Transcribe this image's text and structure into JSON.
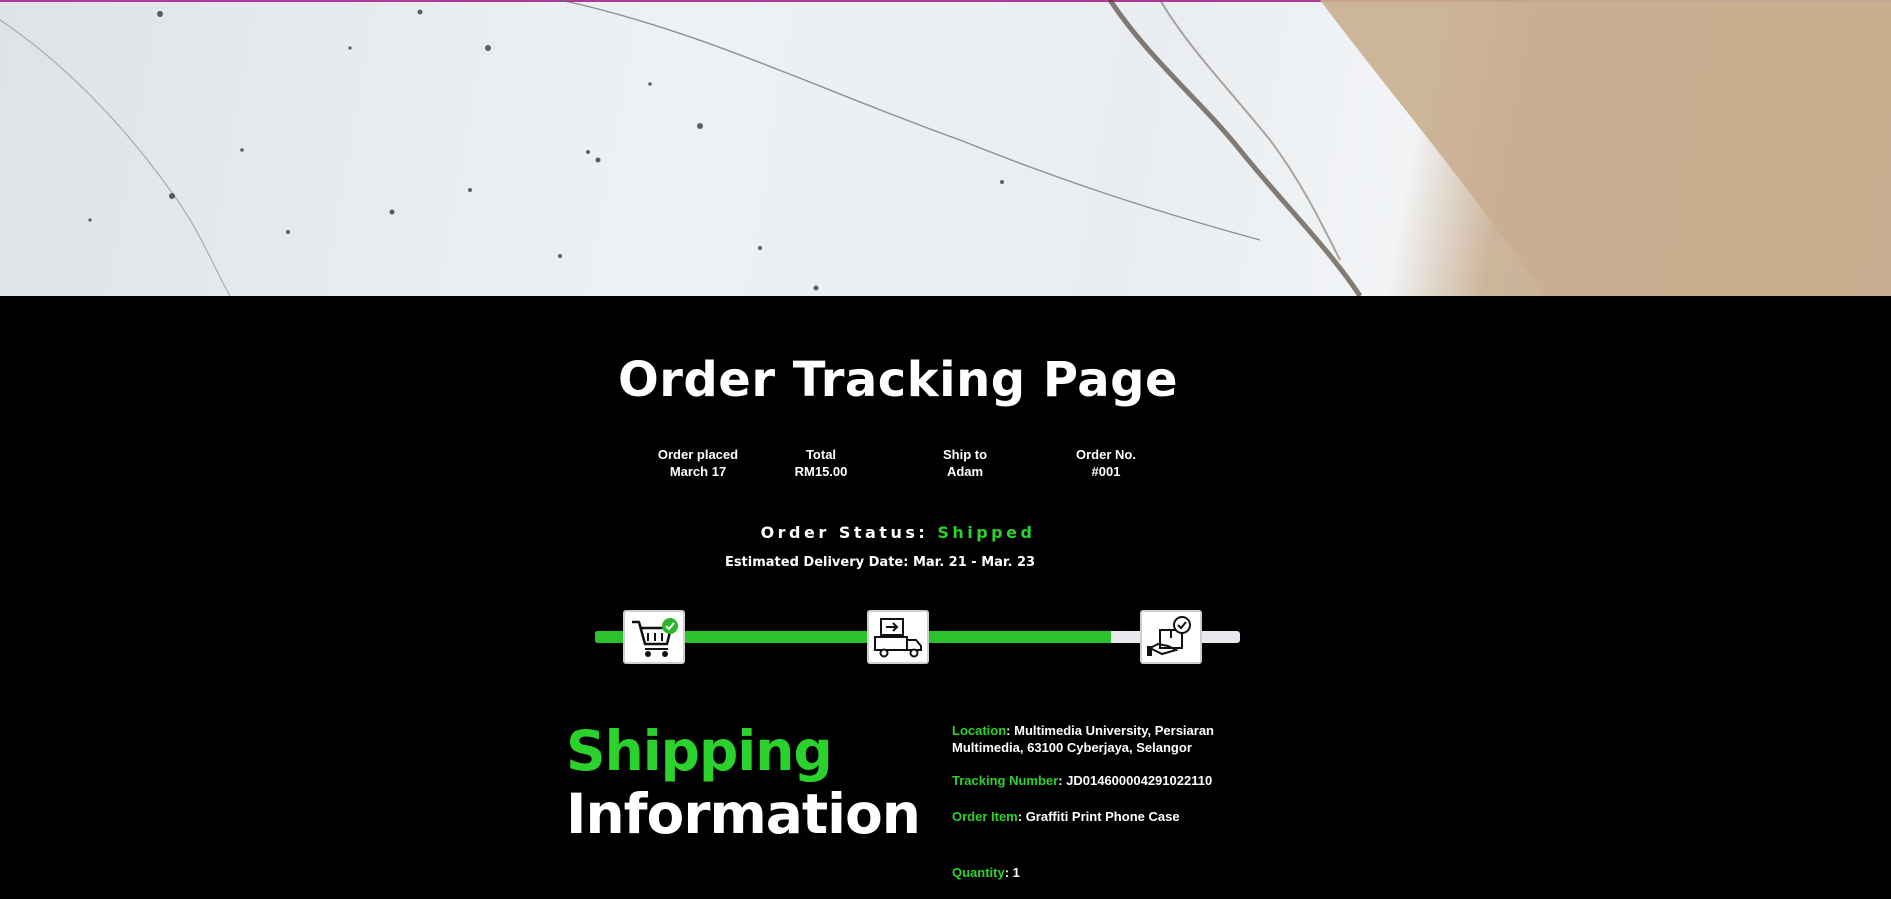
{
  "page": {
    "title": "Order Tracking Page"
  },
  "order_summary": [
    {
      "label": "Order placed",
      "value": "March 17"
    },
    {
      "label": "Total",
      "value": "RM15.00"
    },
    {
      "label": "Ship to",
      "value": "Adam"
    },
    {
      "label": "Order No.",
      "value": "#001"
    }
  ],
  "status": {
    "label": "Order Status: ",
    "value": "Shipped",
    "estimated_delivery": "Estimated Delivery Date: Mar. 21 - Mar. 23"
  },
  "progress": {
    "fraction_complete": 0.8,
    "steps": [
      {
        "icon": "shopping-cart-check-icon",
        "done": true
      },
      {
        "icon": "delivery-truck-icon",
        "done": true
      },
      {
        "icon": "package-received-icon",
        "done": false
      }
    ]
  },
  "shipping": {
    "title_line1": "Shipping",
    "title_line2": "Information",
    "location_label": "Location",
    "location_value": ": Multimedia University, Persiaran Multimedia, 63100 Cyberjaya, Selangor",
    "tracking_label": "Tracking Number",
    "tracking_value": ": JD014600004291022110",
    "item_label": "Order Item",
    "item_value": ": Graffiti Print Phone Case",
    "quantity_label": "Quantity",
    "quantity_value": ": 1"
  },
  "colors": {
    "accent": "#2bd22b",
    "background": "#000000",
    "track_empty": "#e8e8ee"
  }
}
